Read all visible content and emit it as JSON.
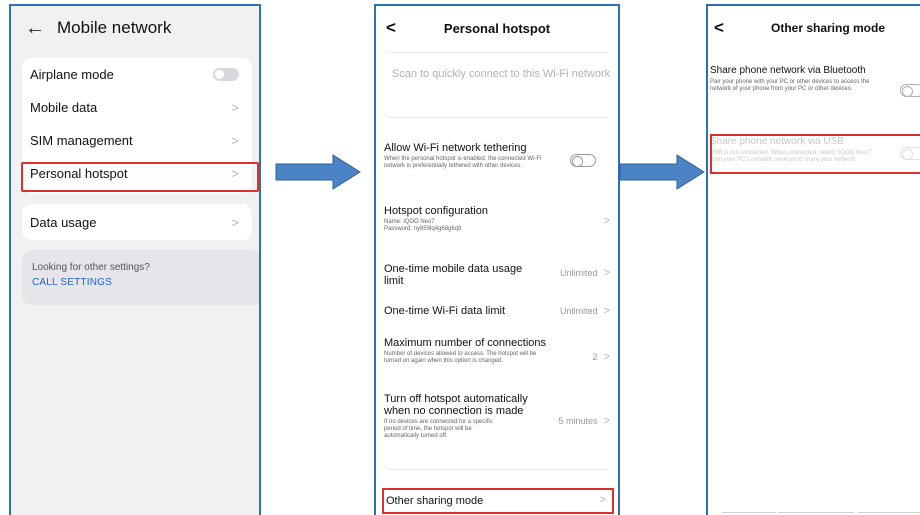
{
  "panel1": {
    "title": "Mobile network",
    "back_icon": "arrow-left-icon",
    "items": [
      {
        "label": "Airplane mode",
        "control": "toggle-off"
      },
      {
        "label": "Mobile data",
        "control": "chevron"
      },
      {
        "label": "SIM management",
        "control": "chevron"
      },
      {
        "label": "Personal hotspot",
        "control": "chevron"
      }
    ],
    "data_usage": "Data usage",
    "other_settings_question": "Looking for other settings?",
    "call_settings": "CALL SETTINGS"
  },
  "panel2": {
    "title": "Personal hotspot",
    "scan_text": "Scan to quickly connect to this Wi-Fi network",
    "allow_title": "Allow Wi-Fi network tethering",
    "allow_desc": "When the personal hotspot is enabled, the connected Wi-Fi network is preferentially tethered with other devices.",
    "hotspot_config_title": "Hotspot configuration",
    "hotspot_name": "Name: iQOO Neo7",
    "hotspot_password": "Password: ny859lq4g68g6q9",
    "mobile_limit_title": "One-time mobile data usage limit",
    "mobile_limit_value": "Unlimited",
    "wifi_limit_title": "One-time Wi-Fi data limit",
    "wifi_limit_value": "Unlimited",
    "max_conn_title": "Maximum number of connections",
    "max_conn_desc": "Number of devices allowed to access. The hotspot will be turned on again when this option is changed.",
    "max_conn_value": "2",
    "auto_off_title": "Turn off hotspot automatically when no connection is made",
    "auto_off_desc": "If no devices are connected for a specific period of time, the hotspot will be automatically turned off.",
    "auto_off_value": "5 minutes",
    "other_sharing": "Other sharing mode"
  },
  "panel3": {
    "title": "Other sharing mode",
    "bt_title": "Share phone network via Bluetooth",
    "bt_desc": "Pair your phone with your PC or other devices to access the network of your phone from your PC or other devices.",
    "usb_title": "Share phone network via USB",
    "usb_desc": "USB is not connected. When connected, select \"iQOO Neo7\" from your PC's network services to share your network."
  },
  "colors": {
    "highlight": "#d9322e",
    "arrow_fill": "#4a84c4",
    "frame": "#2e6fb5",
    "link": "#1f63d6"
  }
}
